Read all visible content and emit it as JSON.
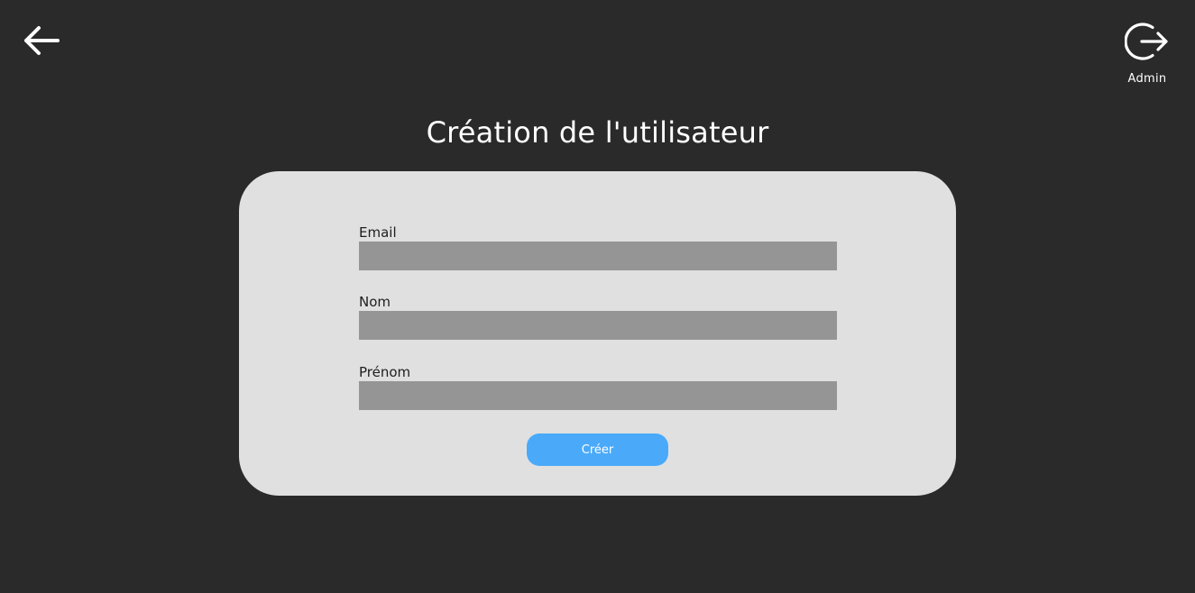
{
  "header": {
    "back_icon": "arrow-left-icon",
    "logout_icon": "logout-icon",
    "user_label": "Admin"
  },
  "page": {
    "title": "Création de l'utilisateur"
  },
  "form": {
    "fields": [
      {
        "label": "Email",
        "value": "",
        "placeholder": ""
      },
      {
        "label": "Nom",
        "value": "",
        "placeholder": ""
      },
      {
        "label": "Prénom",
        "value": "",
        "placeholder": ""
      }
    ],
    "submit_label": "Créer"
  },
  "colors": {
    "background": "#2a2a2a",
    "card": "#e0e0e0",
    "input": "#959595",
    "accent": "#4aaaf9"
  }
}
